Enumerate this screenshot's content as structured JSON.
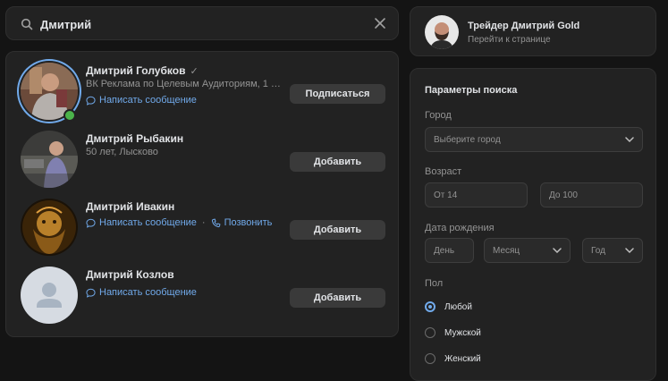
{
  "search": {
    "value": "Дмитрий",
    "icon": "search-icon",
    "clear_icon": "close-icon"
  },
  "colors": {
    "accent": "#71aaeb",
    "background": "#141414",
    "card": "#222222",
    "button": "#3a3a3a",
    "online": "#4bb34b"
  },
  "results": [
    {
      "name": "Дмитрий Голубков",
      "verified_mark": "✓",
      "subtitle": "ВК Реклама по Целевым Аудиториям, 1 87...",
      "message": "Написать сообщение",
      "button": "Подписаться",
      "online": true
    },
    {
      "name": "Дмитрий Рыбакин",
      "subtitle": "50 лет, Лысково",
      "button": "Добавить"
    },
    {
      "name": "Дмитрий Ивакин",
      "message": "Написать сообщение",
      "separator": "·",
      "call": "Позвонить",
      "button": "Добавить"
    },
    {
      "name": "Дмитрий Козлов",
      "message": "Написать сообщение",
      "button": "Добавить"
    }
  ],
  "profile": {
    "name": "Трейдер Дмитрий Gold",
    "link": "Перейти к странице"
  },
  "filters": {
    "title": "Параметры поиска",
    "city_label": "Город",
    "city_placeholder": "Выберите город",
    "age_label": "Возраст",
    "age_from": "От 14",
    "age_to": "До 100",
    "birth_label": "Дата рождения",
    "day": "День",
    "month": "Месяц",
    "year": "Год",
    "gender_label": "Пол",
    "gender_options": [
      "Любой",
      "Мужской",
      "Женский"
    ]
  }
}
